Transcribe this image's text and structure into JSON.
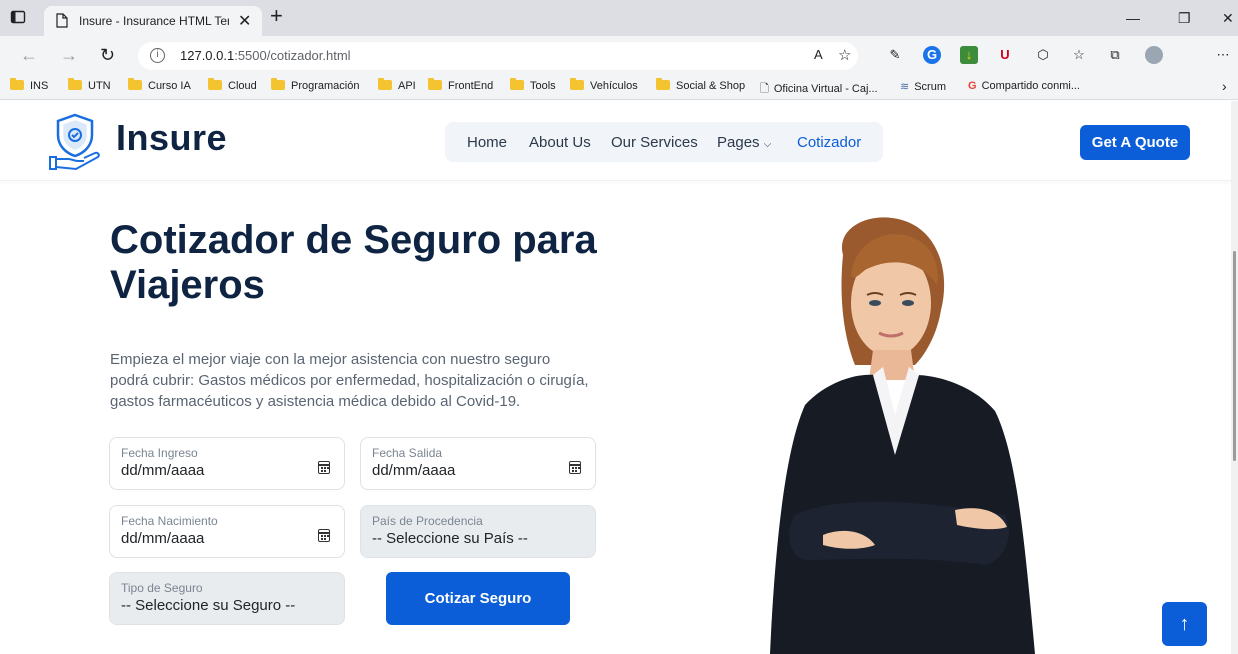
{
  "browser": {
    "tab_title": "Insure - Insurance HTML Templat",
    "tab_close": "✕",
    "new_tab": "+",
    "url_host": "127.0.0.1",
    "url_rest": ":5500/cotizador.html",
    "window_minimize": "—",
    "window_restore": "❐",
    "window_close": "✕",
    "bookmarks": [
      {
        "label": "INS",
        "type": "folder"
      },
      {
        "label": "UTN",
        "type": "folder"
      },
      {
        "label": "Curso IA",
        "type": "folder"
      },
      {
        "label": "Cloud",
        "type": "folder"
      },
      {
        "label": "Programación",
        "type": "folder"
      },
      {
        "label": "API",
        "type": "folder"
      },
      {
        "label": "FrontEnd",
        "type": "folder"
      },
      {
        "label": "Tools",
        "type": "folder"
      },
      {
        "label": "Vehículos",
        "type": "folder"
      },
      {
        "label": "Social & Shop",
        "type": "folder"
      },
      {
        "label": "Oficina Virtual - Caj...",
        "type": "page"
      },
      {
        "label": "Scrum",
        "type": "link"
      },
      {
        "label": "Compartido conmi...",
        "type": "google"
      }
    ],
    "more_bookmarks": "›"
  },
  "header": {
    "logo_text": "Insure",
    "nav": [
      {
        "label": "Home",
        "active": false
      },
      {
        "label": "About Us",
        "active": false
      },
      {
        "label": "Our Services",
        "active": false
      },
      {
        "label": "Pages",
        "active": false,
        "dropdown": true
      },
      {
        "label": "Cotizador",
        "active": true
      }
    ],
    "cta_label": "Get A Quote"
  },
  "hero": {
    "title": "Cotizador de Seguro para Viajeros",
    "description": "Empieza el mejor viaje con la mejor asistencia con nuestro seguro podrá cubrir: Gastos médicos por enfermedad, hospitalización o cirugía, gastos farmacéuticos y asistencia médica debido al Covid-19."
  },
  "form": {
    "fecha_ingreso": {
      "label": "Fecha Ingreso",
      "value": "dd/mm/aaaa"
    },
    "fecha_salida": {
      "label": "Fecha Salida",
      "value": "dd/mm/aaaa"
    },
    "fecha_nacimiento": {
      "label": "Fecha Nacimiento",
      "value": "dd/mm/aaaa"
    },
    "pais": {
      "label": "País de Procedencia",
      "value": "-- Seleccione su País --"
    },
    "tipo_seguro": {
      "label": "Tipo de Seguro",
      "value": "-- Seleccione su Seguro --"
    },
    "submit_label": "Cotizar Seguro"
  },
  "colors": {
    "primary": "#0b5ed7",
    "heading": "#0e2442"
  }
}
